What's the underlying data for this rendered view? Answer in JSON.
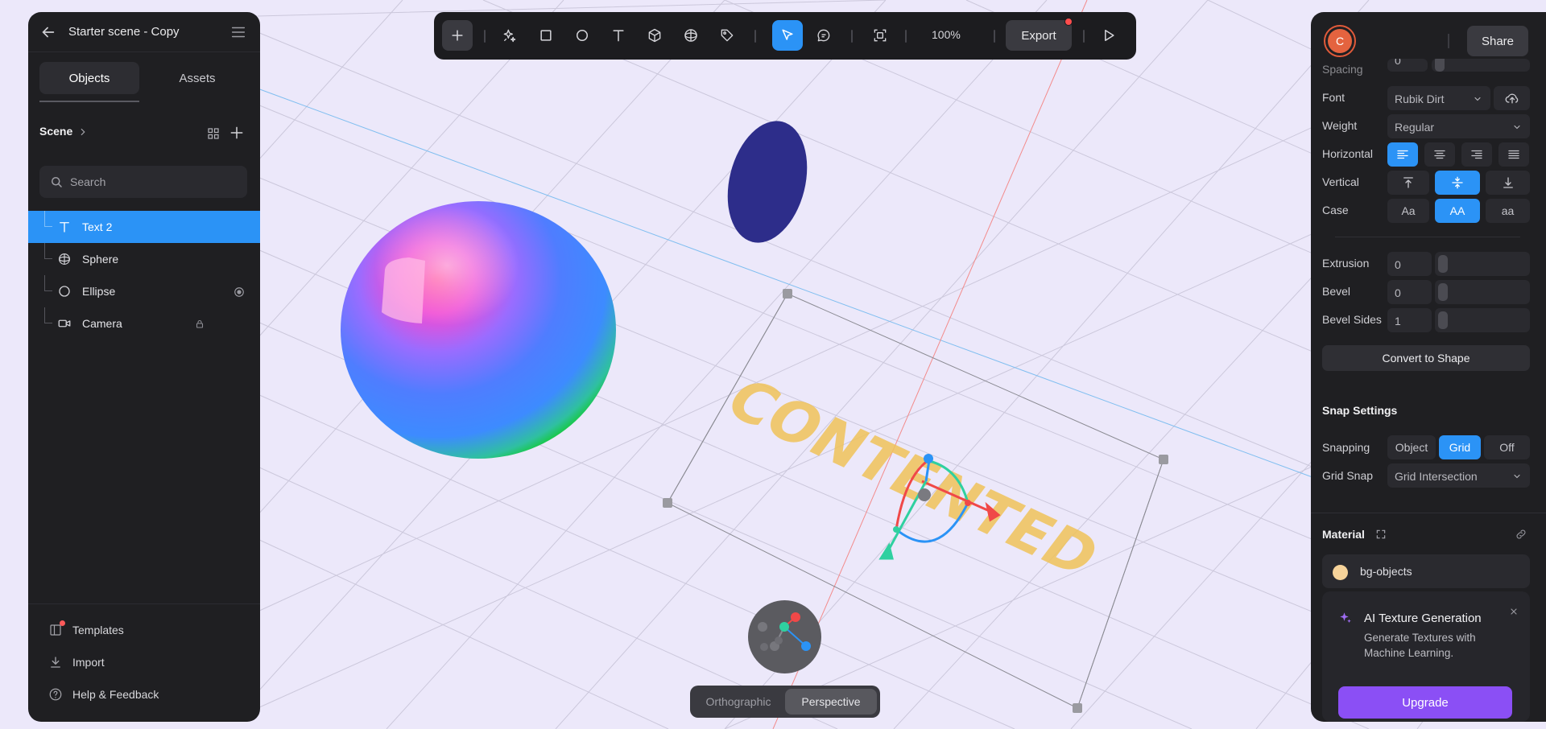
{
  "project": {
    "title": "Starter scene - Copy"
  },
  "left_panel": {
    "tabs": [
      {
        "label": "Objects"
      },
      {
        "label": "Assets"
      }
    ],
    "scene_label": "Scene",
    "search": {
      "placeholder": "Search",
      "value": ""
    },
    "objects": [
      {
        "label": "Text 2",
        "icon": "text-icon",
        "selected": true
      },
      {
        "label": "Sphere",
        "icon": "sphere-icon"
      },
      {
        "label": "Ellipse",
        "icon": "ellipse-icon"
      },
      {
        "label": "Camera",
        "icon": "camera-icon"
      }
    ],
    "footer_links": [
      {
        "label": "Templates",
        "icon": "templates-icon"
      },
      {
        "label": "Import",
        "icon": "import-icon"
      },
      {
        "label": "Help & Feedback",
        "icon": "help-icon"
      }
    ]
  },
  "toolbar": {
    "tools": [
      "add",
      "ai-magic",
      "rectangle",
      "ellipse",
      "text",
      "cube",
      "sphere",
      "path",
      "select",
      "comment",
      "frame"
    ],
    "active_tool": "select",
    "zoom": "100%",
    "export_label": "Export"
  },
  "viewport": {
    "text_object": "CONTENTED",
    "view_modes": {
      "orthographic": "Orthographic",
      "perspective": "Perspective",
      "active": "Perspective"
    },
    "colors": {
      "background": "#ece8fa",
      "text_fill": "#f0c35a",
      "ellipse_fill": "#2d2d8a"
    }
  },
  "right_panel": {
    "avatar_initial": "C",
    "share_label": "Share",
    "spacing_label": "Spacing",
    "spacing_value": "0",
    "font_label": "Font",
    "font_value": "Rubik Dirt",
    "weight_label": "Weight",
    "weight_value": "Regular",
    "horizontal_label": "Horizontal",
    "vertical_label": "Vertical",
    "case_label": "Case",
    "case_options": [
      "Aa",
      "AA",
      "aa"
    ],
    "extrusion_label": "Extrusion",
    "extrusion_value": "0",
    "bevel_label": "Bevel",
    "bevel_value": "0",
    "bevel_sides_label": "Bevel Sides",
    "bevel_sides_value": "1",
    "convert_label": "Convert to Shape",
    "snap_heading": "Snap Settings",
    "snapping_label": "Snapping",
    "snapping_options": [
      "Object",
      "Grid",
      "Off"
    ],
    "snapping_active": "Grid",
    "grid_snap_label": "Grid Snap",
    "grid_snap_value": "Grid Intersection",
    "material_heading": "Material",
    "material_name": "bg-objects",
    "material_color": "#f6d39a",
    "ai_card": {
      "title": "AI Texture Generation",
      "description": "Generate Textures with Machine Learning.",
      "upgrade_label": "Upgrade"
    }
  },
  "accent_color": "#2b93f6"
}
